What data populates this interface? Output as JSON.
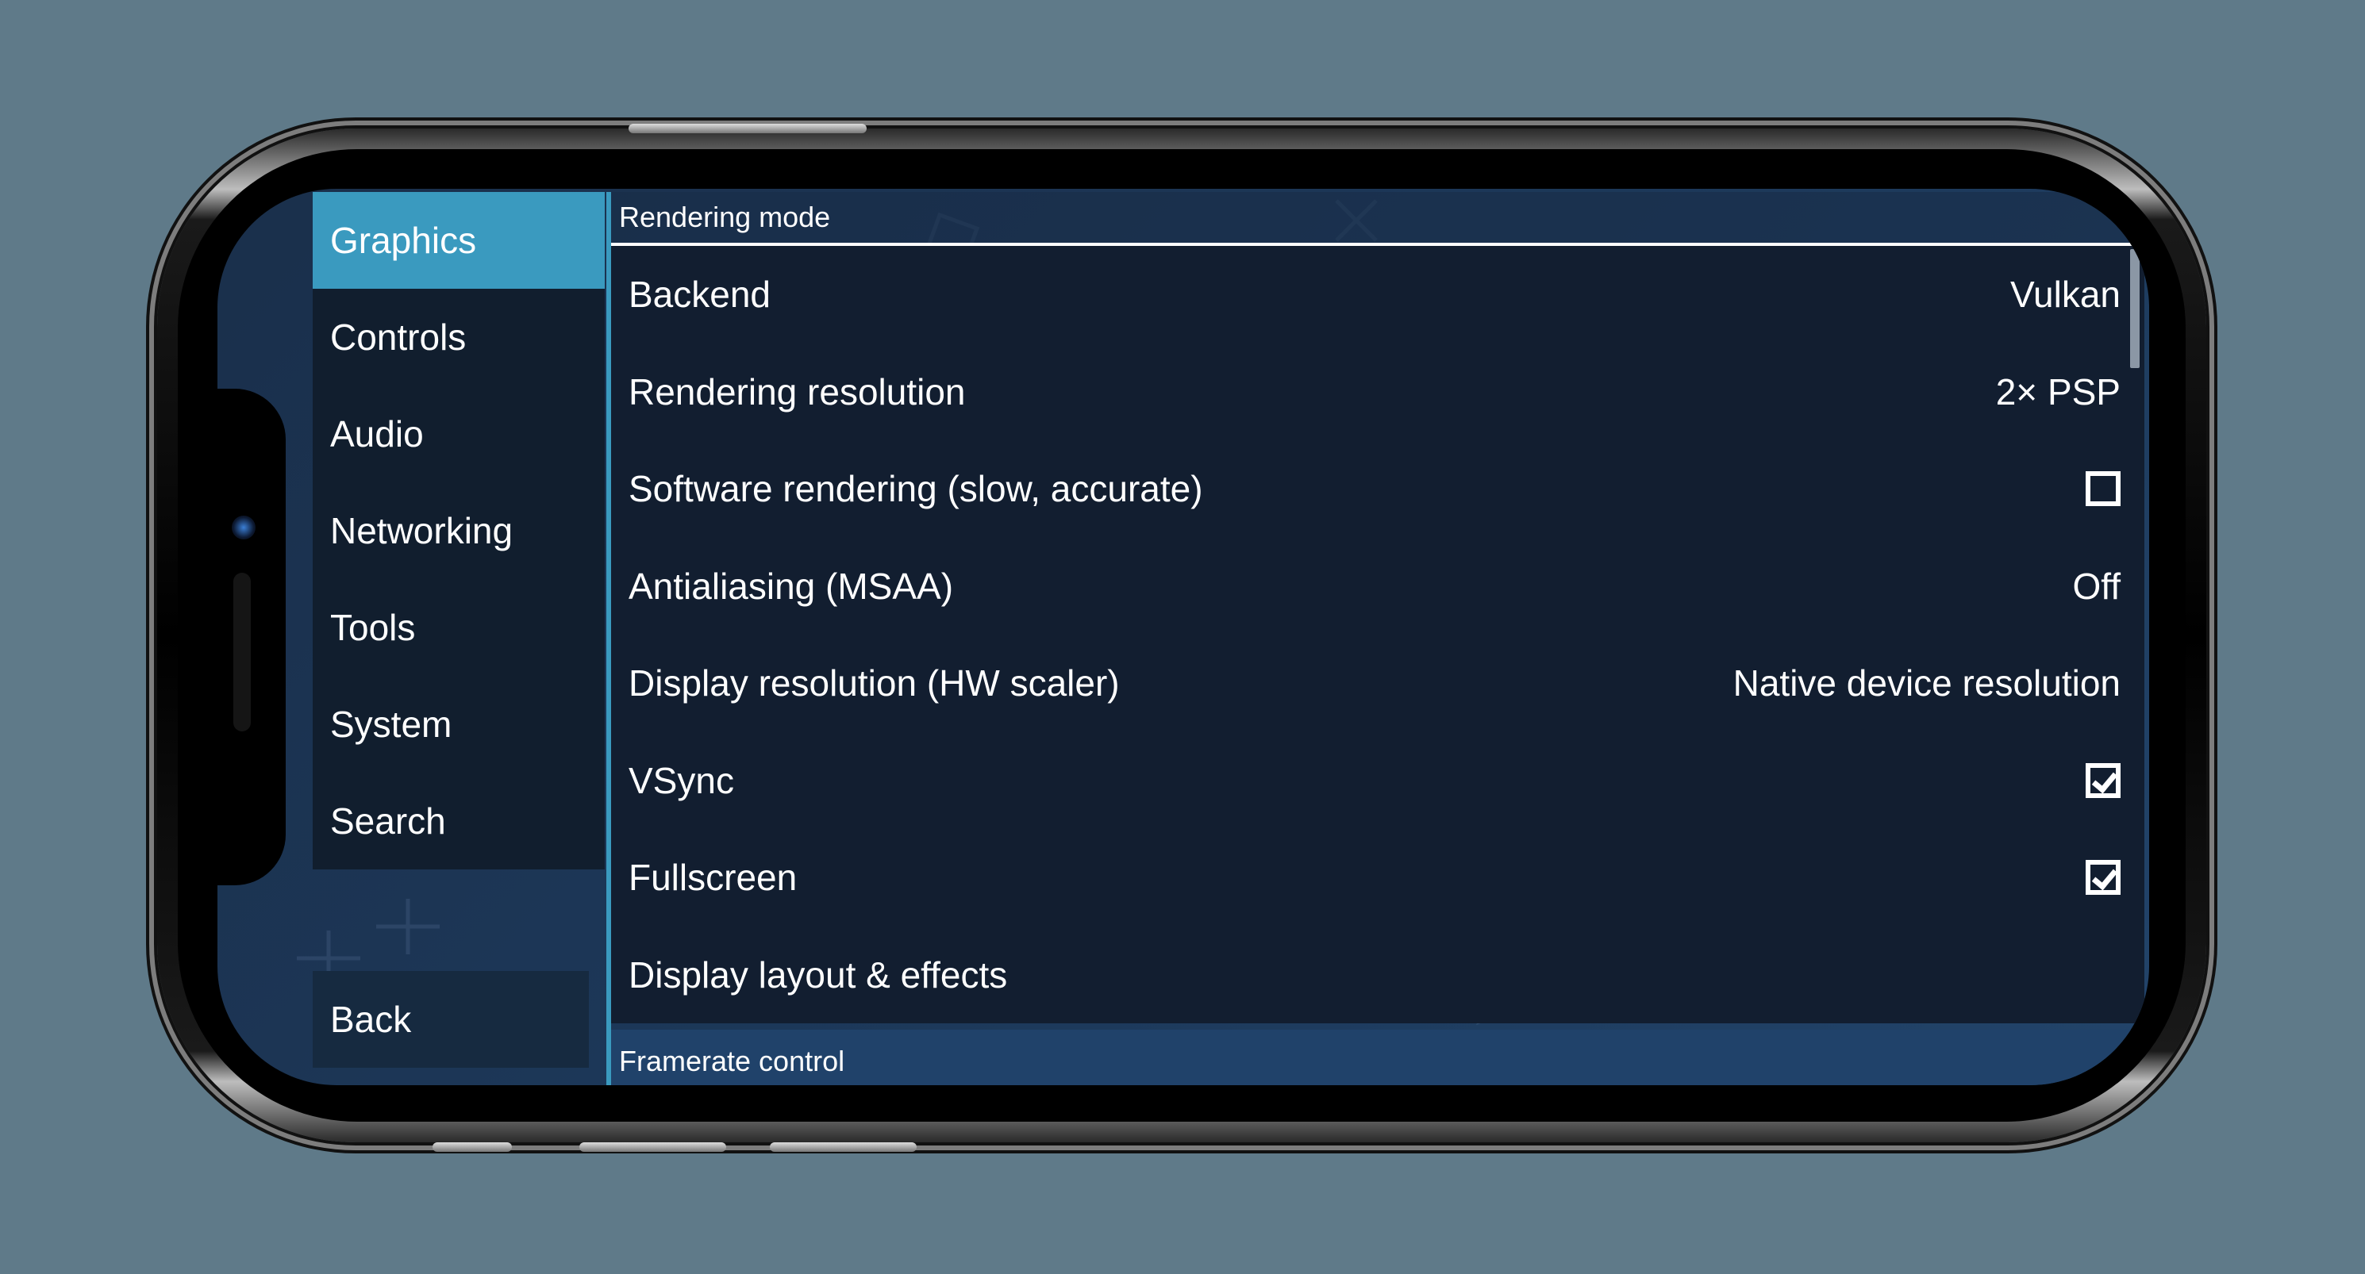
{
  "sidebar": {
    "items": [
      {
        "label": "Graphics",
        "active": true
      },
      {
        "label": "Controls",
        "active": false
      },
      {
        "label": "Audio",
        "active": false
      },
      {
        "label": "Networking",
        "active": false
      },
      {
        "label": "Tools",
        "active": false
      },
      {
        "label": "System",
        "active": false
      },
      {
        "label": "Search",
        "active": false
      }
    ],
    "back_label": "Back"
  },
  "content": {
    "section_title": "Rendering mode",
    "rows": [
      {
        "label": "Backend",
        "type": "value",
        "value": "Vulkan"
      },
      {
        "label": "Rendering resolution",
        "type": "value",
        "value": "2× PSP"
      },
      {
        "label": "Software rendering (slow, accurate)",
        "type": "checkbox",
        "checked": false
      },
      {
        "label": "Antialiasing (MSAA)",
        "type": "value",
        "value": "Off"
      },
      {
        "label": "Display resolution (HW scaler)",
        "type": "value",
        "value": "Native device resolution"
      },
      {
        "label": "VSync",
        "type": "checkbox",
        "checked": true
      },
      {
        "label": "Fullscreen",
        "type": "checkbox",
        "checked": true
      },
      {
        "label": "Display layout & effects",
        "type": "link",
        "value": ""
      }
    ],
    "next_section_title": "Framerate control"
  },
  "colors": {
    "accent": "#3a9abf",
    "panel": "#121e30",
    "background": "#5f7a89"
  }
}
